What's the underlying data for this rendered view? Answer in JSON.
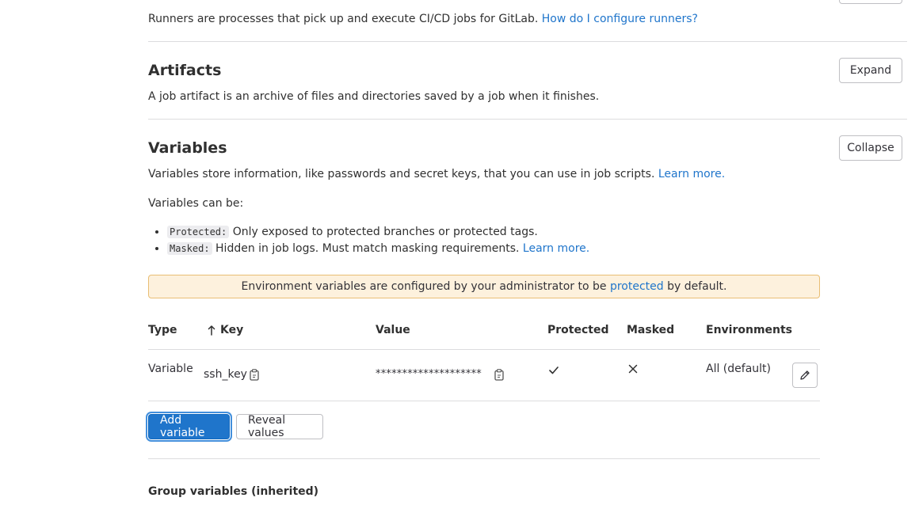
{
  "runners": {
    "description": "Runners are processes that pick up and execute CI/CD jobs for GitLab.",
    "help_link": "How do I configure runners?"
  },
  "artifacts": {
    "title": "Artifacts",
    "description": "A job artifact is an archive of files and directories saved by a job when it finishes.",
    "toggle_label": "Expand"
  },
  "variables": {
    "title": "Variables",
    "description": "Variables store information, like passwords and secret keys, that you can use in job scripts.",
    "learn_more": "Learn more.",
    "toggle_label": "Collapse",
    "can_be_label": "Variables can be:",
    "bullets": [
      {
        "code": "Protected:",
        "text": "Only exposed to protected branches or protected tags.",
        "link": ""
      },
      {
        "code": "Masked:",
        "text": "Hidden in job logs. Must match masking requirements.",
        "link": "Learn more."
      }
    ],
    "alert": {
      "before": "Environment variables are configured by your administrator to be",
      "link": "protected",
      "after": "by default."
    },
    "table": {
      "headers": {
        "type": "Type",
        "key": "Key",
        "value": "Value",
        "protected": "Protected",
        "masked": "Masked",
        "environments": "Environments"
      },
      "sort_icon": "arrow-up-icon",
      "rows": [
        {
          "type": "Variable",
          "key": "ssh_key",
          "value": "********************",
          "protected_icon": "check-icon",
          "masked_icon": "close-icon",
          "environments": "All (default)"
        }
      ]
    },
    "add_button": "Add variable",
    "reveal_button": "Reveal values",
    "group_heading": "Group variables (inherited)"
  },
  "colors": {
    "link": "#1f75cb",
    "primary": "#1f75cb",
    "alert_bg": "#fdf1dd",
    "alert_border": "#e9be74"
  }
}
